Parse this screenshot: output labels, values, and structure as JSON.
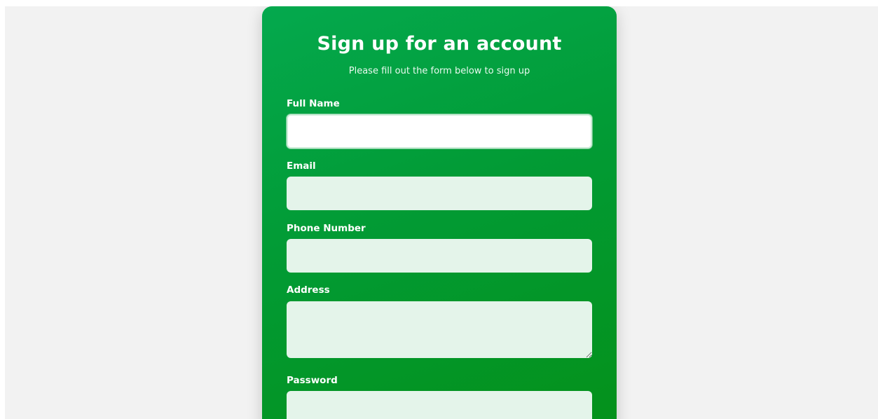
{
  "form": {
    "title": "Sign up for an account",
    "subtitle": "Please fill out the form below to sign up",
    "fields": [
      {
        "label": "Full Name",
        "value": "",
        "focused": true
      },
      {
        "label": "Email",
        "value": ""
      },
      {
        "label": "Phone Number",
        "value": ""
      },
      {
        "label": "Address",
        "value": ""
      },
      {
        "label": "Password",
        "value": ""
      }
    ]
  },
  "colors": {
    "page_background": "#f2f2f2",
    "card_gradient_start": "#04a94e",
    "card_gradient_end": "#04911a",
    "input_background": "#e4f4ea",
    "input_focused_background": "#ffffff",
    "text": "#ffffff"
  }
}
